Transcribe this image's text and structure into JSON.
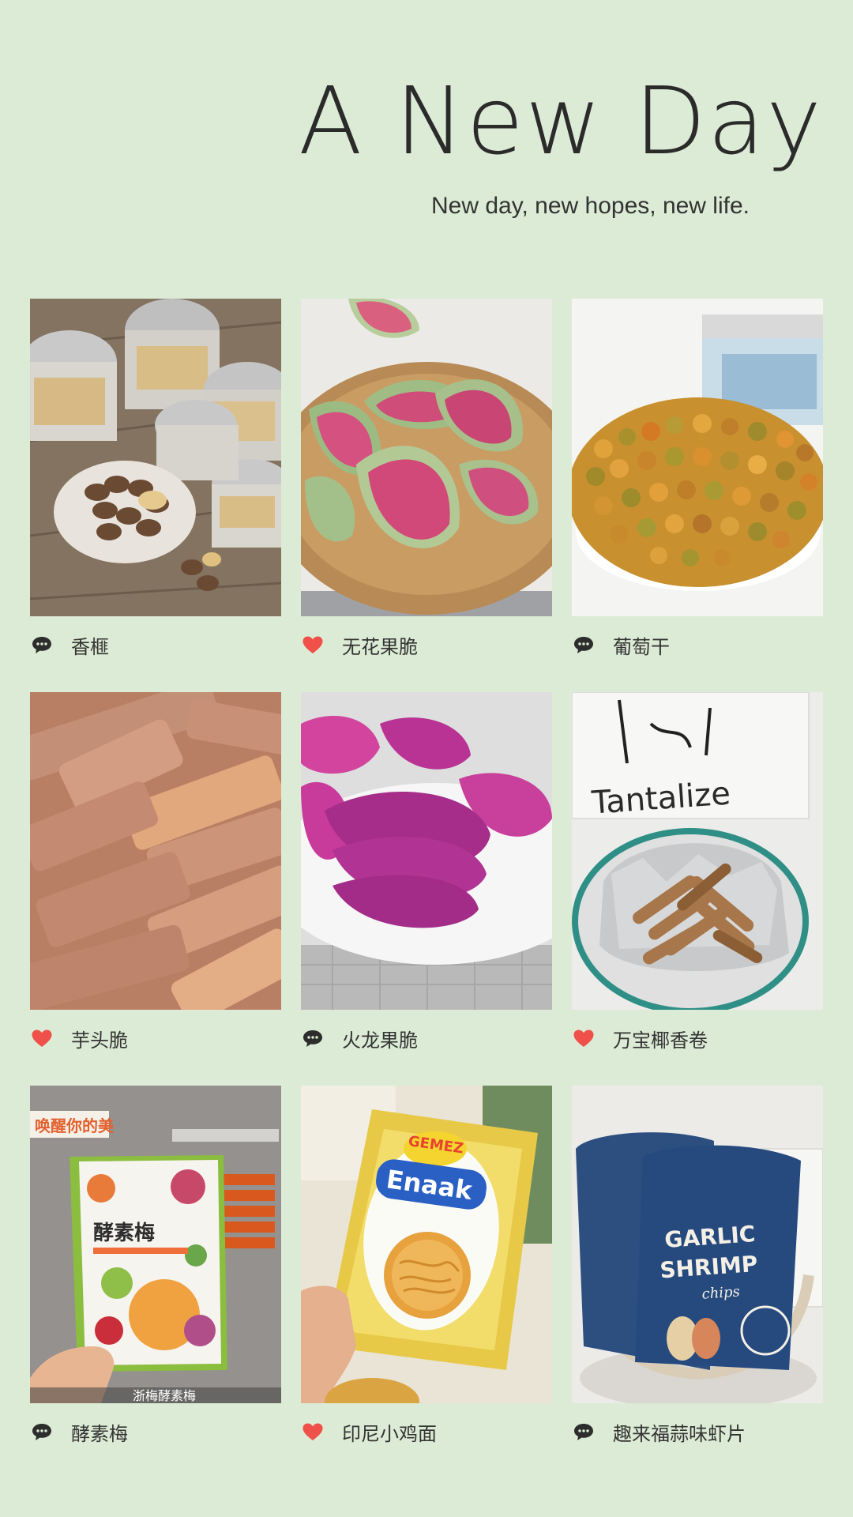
{
  "header": {
    "title": "A New Day",
    "subtitle": "New day, new hopes, new life."
  },
  "colors": {
    "background": "#dcebd5",
    "heart": "#f0504a",
    "comment": "#2d2d2d",
    "text": "#333333"
  },
  "items": [
    {
      "label": "香榧",
      "icon": "comment-icon",
      "photo": "pecans in jars"
    },
    {
      "label": "无花果脆",
      "icon": "heart-icon",
      "photo": "fig slices in basket"
    },
    {
      "label": "葡萄干",
      "icon": "comment-icon",
      "photo": "raisins in bowl"
    },
    {
      "label": "芋头脆",
      "icon": "heart-icon",
      "photo": "taro sticks"
    },
    {
      "label": "火龙果脆",
      "icon": "comment-icon",
      "photo": "dragon fruit crisps"
    },
    {
      "label": "万宝椰香卷",
      "icon": "heart-icon",
      "photo": "coconut rolls tin"
    },
    {
      "label": "酵素梅",
      "icon": "comment-icon",
      "photo": "enzyme plum bag"
    },
    {
      "label": "印尼小鸡面",
      "icon": "heart-icon",
      "photo": "chicken noodle snack"
    },
    {
      "label": "趣来福蒜味虾片",
      "icon": "comment-icon",
      "photo": "garlic shrimp chips"
    }
  ],
  "photo_text": {
    "tantalize": "Tantalize",
    "enaak": "Enaak",
    "gemez": "GEMEZ",
    "garlic": "GARLIC",
    "shrimp": "SHRIMP",
    "chips": "chips",
    "plum_bag": "酵素梅",
    "plum_top": "唤醒你的美",
    "plum_bottom": "浙梅酵素梅"
  }
}
